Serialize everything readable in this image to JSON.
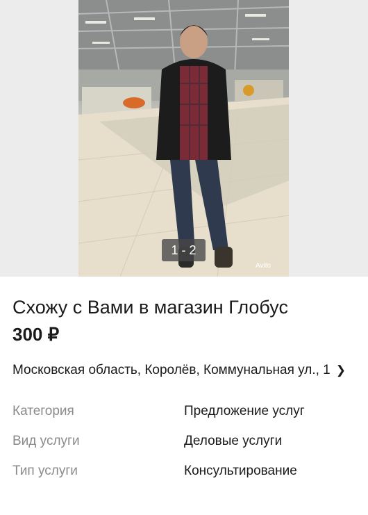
{
  "gallery": {
    "counter": "1 - 2",
    "watermark": "Avito"
  },
  "listing": {
    "title": "Схожу с Вами в магазин Глобус",
    "price": "300 ₽",
    "address": "Московская область, Королёв, Коммунальная ул., 1"
  },
  "params": [
    {
      "label": "Категория",
      "value": "Предложение услуг"
    },
    {
      "label": "Вид услуги",
      "value": "Деловые услуги"
    },
    {
      "label": "Тип услуги",
      "value": "Консультирование"
    }
  ],
  "icons": {
    "address_chevron": "chevron-right-icon"
  }
}
